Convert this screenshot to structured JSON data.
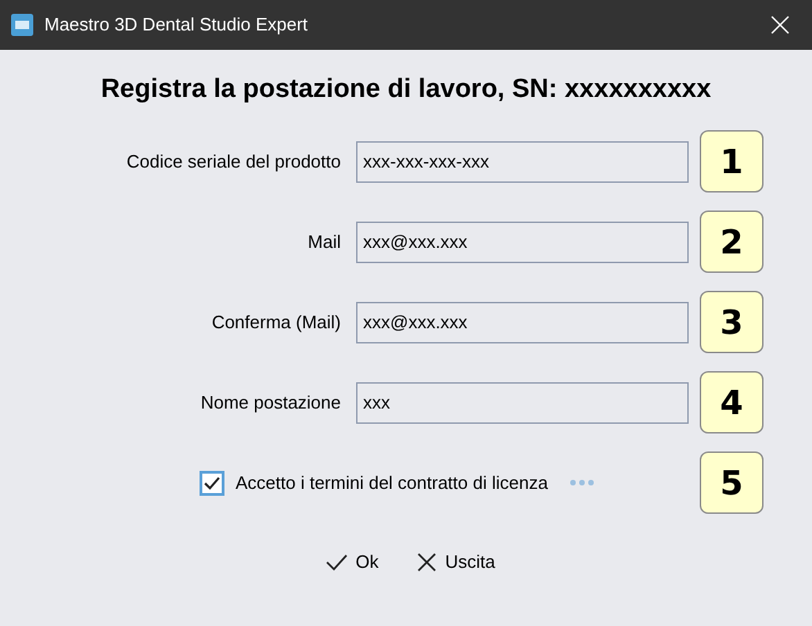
{
  "window": {
    "title": "Maestro 3D Dental Studio Expert"
  },
  "heading": "Registra la postazione di lavoro, SN: xxxxxxxxxx",
  "fields": [
    {
      "label": "Codice seriale del prodotto",
      "value": "xxx-xxx-xxx-xxx",
      "step": "1"
    },
    {
      "label": "Mail",
      "value": "xxx@xxx.xxx",
      "step": "2"
    },
    {
      "label": "Conferma (Mail)",
      "value": "xxx@xxx.xxx",
      "step": "3"
    },
    {
      "label": "Nome postazione",
      "value": "xxx",
      "step": "4"
    }
  ],
  "license": {
    "label": "Accetto i termini del contratto di licenza",
    "checked": true,
    "step": "5"
  },
  "buttons": [
    {
      "label": "Ok",
      "kind": "ok"
    },
    {
      "label": "Uscita",
      "kind": "cancel"
    }
  ]
}
